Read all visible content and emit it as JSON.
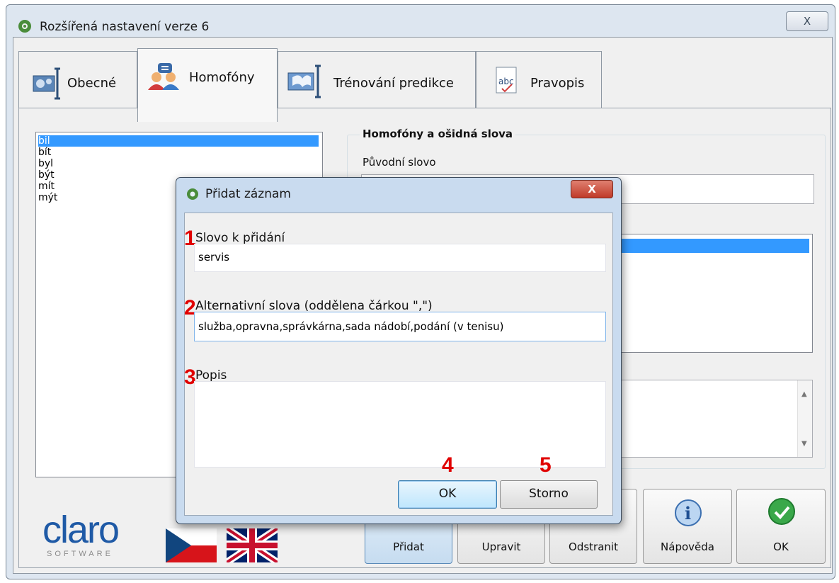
{
  "window": {
    "title": "Rozšířená nastavení verze 6",
    "close_glyph": "X"
  },
  "tabs": [
    {
      "label": "Obecné",
      "icon": "settings-icon"
    },
    {
      "label": "Homofóny",
      "icon": "people-icon"
    },
    {
      "label": "Trénování predikce",
      "icon": "book-icon"
    },
    {
      "label": "Pravopis",
      "icon": "spellcheck-icon"
    }
  ],
  "active_tab": "Homofóny",
  "word_list": {
    "items": [
      "bil",
      "bít",
      "byl",
      "být",
      "mít",
      "mýt"
    ],
    "selected": "bil"
  },
  "group": {
    "title": "Homofóny a ošidná slova",
    "original_word_label": "Původní slovo",
    "original_word_value": ""
  },
  "buttons": {
    "add": "Přidat",
    "edit": "Upravit",
    "remove": "Odstranit",
    "help": "Nápověda",
    "ok": "OK"
  },
  "logo": {
    "brand": "claro",
    "sub": "SOFTWARE"
  },
  "flags": [
    "Czech",
    "English"
  ],
  "dialog": {
    "title": "Přidat záznam",
    "field1_label": "Slovo k přidání",
    "field1_value": "servis",
    "field2_label": "Alternativní slova (oddělena čárkou \",\")",
    "field2_value": "služba,opravna,správkárna,sada nádobí,podání (v tenisu)",
    "field3_label": "Popis",
    "field3_value": "",
    "ok": "OK",
    "cancel": "Storno",
    "markers": [
      "1",
      "2",
      "3",
      "4",
      "5"
    ]
  },
  "colors": {
    "selection": "#3399ff",
    "marker": "#e00000",
    "close_red": "#c8402f"
  }
}
